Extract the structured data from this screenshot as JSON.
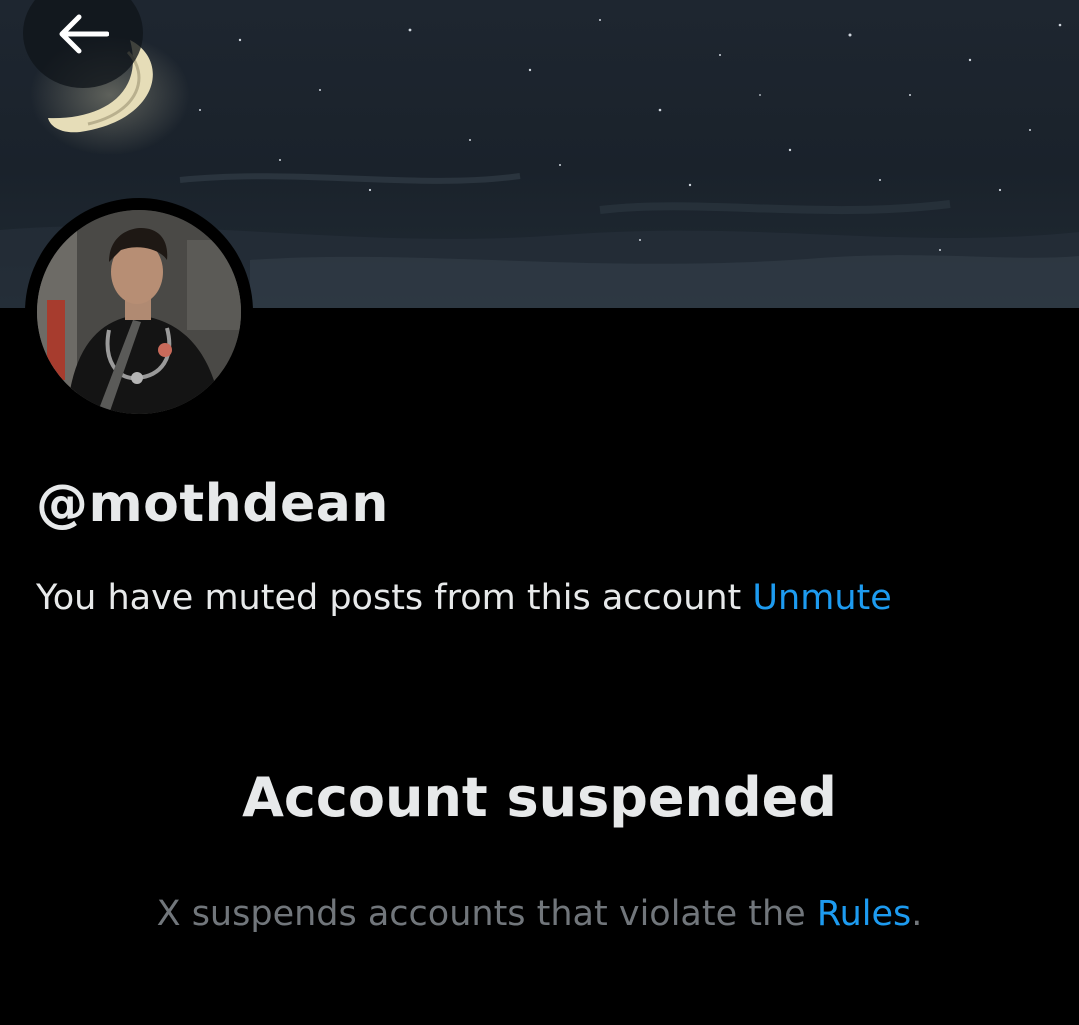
{
  "header": {
    "back_icon": "arrow-left-icon",
    "banner_description": "night-sky-painting"
  },
  "profile": {
    "handle": "@mothdean",
    "muted_text": "You have muted posts from this account",
    "unmute_label": "Unmute"
  },
  "suspension": {
    "title": "Account suspended",
    "text_before": "X suspends accounts that violate the",
    "rules_link": "Rules",
    "text_after": "."
  },
  "colors": {
    "background": "#000000",
    "text": "#e7e9ea",
    "secondary_text": "#71767b",
    "link": "#1d9bf0"
  }
}
